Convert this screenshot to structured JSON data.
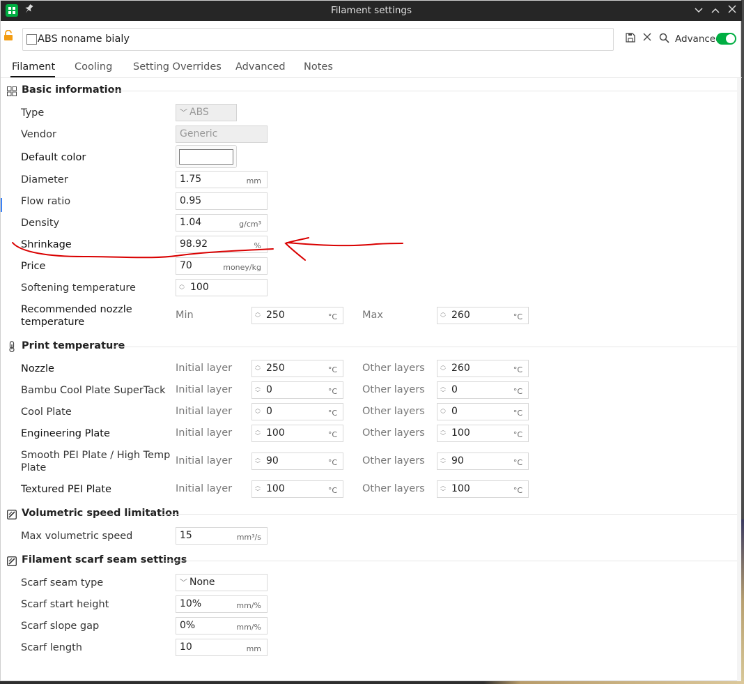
{
  "window": {
    "title": "Filament settings",
    "preset_name": "ABS noname bialy",
    "advanced_label": "Advanced",
    "advanced_on": true
  },
  "tabs": [
    {
      "label": "Filament",
      "active": true
    },
    {
      "label": "Cooling",
      "active": false
    },
    {
      "label": "Setting Overrides",
      "active": false
    },
    {
      "label": "Advanced",
      "active": false
    },
    {
      "label": "Notes",
      "active": false
    }
  ],
  "basic": {
    "title": "Basic information",
    "type": {
      "label": "Type",
      "value": "ABS"
    },
    "vendor": {
      "label": "Vendor",
      "value": "Generic"
    },
    "default_color": {
      "label": "Default color",
      "value": "#ffffff"
    },
    "diameter": {
      "label": "Diameter",
      "value": "1.75",
      "unit": "mm"
    },
    "flow_ratio": {
      "label": "Flow ratio",
      "value": "0.95"
    },
    "density": {
      "label": "Density",
      "value": "1.04",
      "unit": "g/cm³"
    },
    "shrinkage": {
      "label": "Shrinkage",
      "value": "98.92",
      "unit": "%"
    },
    "price": {
      "label": "Price",
      "value": "70",
      "unit": "money/kg"
    },
    "softening": {
      "label": "Softening temperature",
      "value": "100"
    },
    "nozzle_temp": {
      "label_line1": "Recommended nozzle",
      "label_line2": "temperature",
      "min_label": "Min",
      "min_value": "250",
      "max_label": "Max",
      "max_value": "260",
      "unit": "°C"
    }
  },
  "print_temp": {
    "title": "Print temperature",
    "initial_label": "Initial layer",
    "other_label": "Other layers",
    "unit": "°C",
    "rows": [
      {
        "label": "Nozzle",
        "initial": "250",
        "other": "260"
      },
      {
        "label": "Bambu Cool Plate SuperTack",
        "initial": "0",
        "other": "0"
      },
      {
        "label": "Cool Plate",
        "initial": "0",
        "other": "0"
      },
      {
        "label": "Engineering Plate",
        "initial": "100",
        "other": "100"
      },
      {
        "label_line1": "Smooth PEI Plate / High Temp",
        "label_line2": "Plate",
        "initial": "90",
        "other": "90"
      },
      {
        "label": "Textured PEI Plate",
        "initial": "100",
        "other": "100"
      }
    ]
  },
  "volumetric": {
    "title": "Volumetric speed limitation",
    "max_speed": {
      "label": "Max volumetric speed",
      "value": "15",
      "unit": "mm³/s"
    }
  },
  "scarf": {
    "title": "Filament scarf seam settings",
    "type": {
      "label": "Scarf seam type",
      "value": "None"
    },
    "start_height": {
      "label": "Scarf start height",
      "value": "10%",
      "unit": "mm/%"
    },
    "slope_gap": {
      "label": "Scarf slope gap",
      "value": "0%",
      "unit": "mm/%"
    },
    "length": {
      "label": "Scarf length",
      "value": "10",
      "unit": "mm"
    }
  },
  "colors": {
    "accent": "#00ae42",
    "annotation": "#d90000",
    "titlebar": "#262626"
  },
  "icons": [
    "app-icon",
    "pin-icon",
    "chevron-down-icon",
    "chevron-up-icon",
    "close-icon",
    "lock-icon",
    "save-icon",
    "search-icon",
    "grid-icon",
    "thermometer-icon",
    "box-icon"
  ]
}
